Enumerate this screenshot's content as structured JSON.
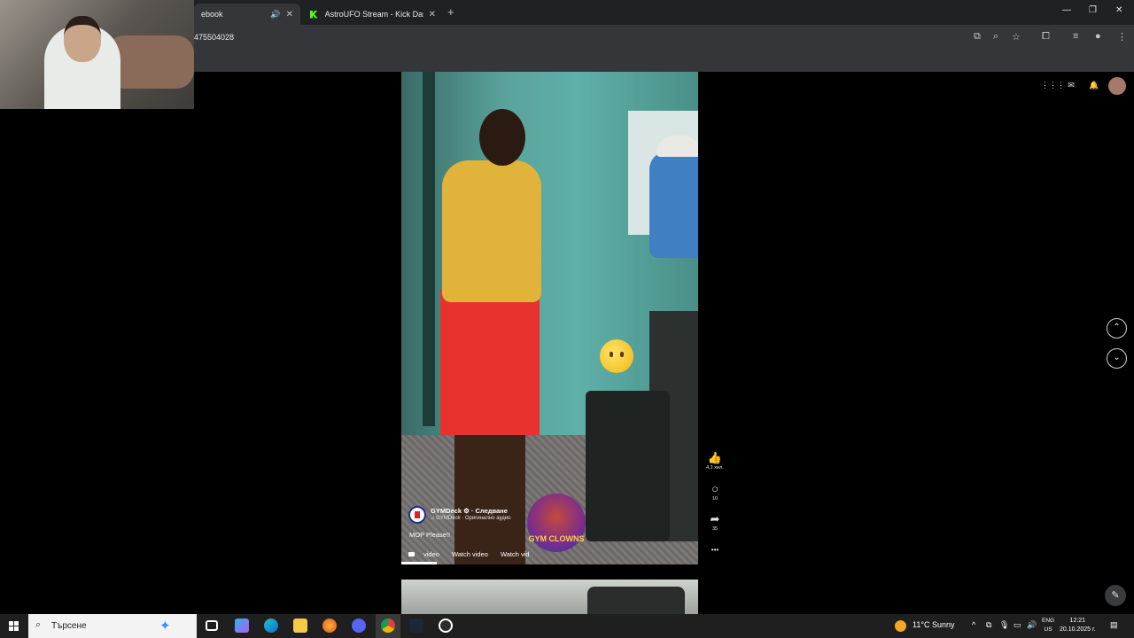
{
  "browser": {
    "tabs": [
      {
        "title": "ebook",
        "audio_icon": "speaker-icon",
        "active": true
      },
      {
        "title": "AstroUFO Stream - Kick Dashb",
        "active": false
      }
    ],
    "new_tab_label": "+",
    "url": "475504028",
    "window_controls": {
      "minimize": "—",
      "restore": "❐",
      "close": "✕"
    }
  },
  "reel": {
    "page_name": "GYMDeck ⚙ · Следване",
    "audio": "♫ GYMDeck · Оригинално аудио",
    "caption": "MOP Please!!",
    "logo_text": "GYM CLOWNS",
    "chips": [
      "video",
      "Watch video",
      "Watch vid"
    ],
    "actions": [
      {
        "icon": "like-icon",
        "glyph": "👍",
        "count": "4,1 хил."
      },
      {
        "icon": "comment-icon",
        "glyph": "○",
        "count": "10"
      },
      {
        "icon": "share-icon",
        "glyph": "➦",
        "count": "35"
      },
      {
        "icon": "more-icon",
        "glyph": "•••",
        "count": ""
      }
    ],
    "progress": 0.12
  },
  "facebook": {
    "menu_glyph": "⋮⋮⋮",
    "messenger_glyph": "✉",
    "notifications_glyph": "🔔",
    "prev_glyph": "⌃",
    "next_glyph": "⌄",
    "compose_glyph": "✎"
  },
  "taskbar": {
    "search_placeholder": "Търсене",
    "weather": "11°C  Sunny",
    "lang_top": "ENG",
    "lang_bottom": "US",
    "time": "12:21",
    "date": "20.10.2025 г.",
    "tray_up": "^"
  },
  "colors": {
    "accent_green": "#53fc18",
    "shorts_red": "#e8322d",
    "tank_yellow": "#e2b33a"
  }
}
